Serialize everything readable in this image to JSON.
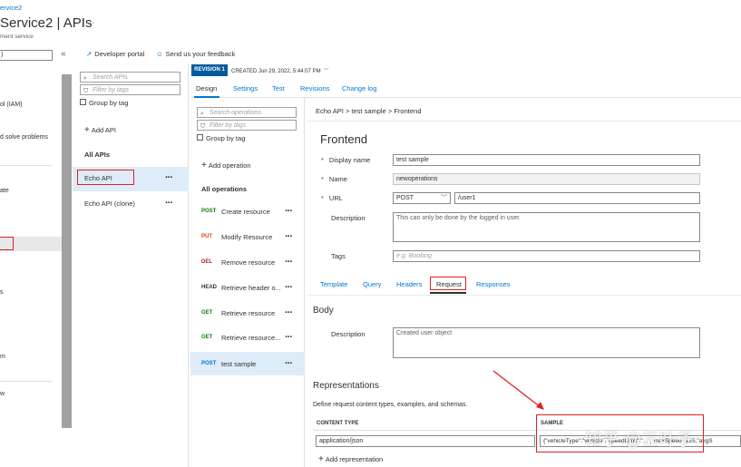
{
  "header": {
    "breadcrumb_fragment": "ervice2",
    "title": "Service2 | APIs",
    "more": "···",
    "subtitle": "ment service"
  },
  "toolbar": {
    "developer_portal": "Developer portal",
    "feedback": "Send us your feedback"
  },
  "left_nav": {
    "search_fragment": ")",
    "collapse": "«",
    "items": [
      "ol (IAM)",
      "d solve problems",
      "ate",
      "s",
      "m",
      "w"
    ]
  },
  "api_list": {
    "search_placeholder": "Search APIs",
    "filter_placeholder": "Filter by tags",
    "group_by_tag": "Group by tag",
    "add_api": "Add API",
    "all_apis": "All APIs",
    "apis": [
      "Echo API",
      "Echo API (clone)"
    ]
  },
  "revision": {
    "badge": "REVISION 1",
    "created": "CREATED Jun 29, 2022, 5:44:07 PM"
  },
  "design_tabs": [
    "Design",
    "Settings",
    "Test",
    "Revisions",
    "Change log"
  ],
  "operations": {
    "search_placeholder": "Search operations",
    "filter_placeholder": "Filter by tags",
    "group_by_tag": "Group by tag",
    "add_operation": "Add operation",
    "all_operations": "All operations",
    "items": [
      {
        "verb": "POST",
        "name": "Create resource",
        "color": "#107c10"
      },
      {
        "verb": "PUT",
        "name": "Modify Resource",
        "color": "#d83b01"
      },
      {
        "verb": "DEL",
        "name": "Remove resource",
        "color": "#a4262c"
      },
      {
        "verb": "HEAD",
        "name": "Retrieve header o...",
        "color": "#323130"
      },
      {
        "verb": "GET",
        "name": "Retrieve resource",
        "color": "#107c10"
      },
      {
        "verb": "GET",
        "name": "Retrieve resource...",
        "color": "#107c10"
      },
      {
        "verb": "POST",
        "name": "test sample",
        "color": "#0078d4"
      }
    ]
  },
  "detail": {
    "breadcrumb": [
      "Echo API",
      "test sample",
      "Frontend"
    ],
    "heading": "Frontend",
    "display_name_label": "Display name",
    "display_name_value": "test sample",
    "name_label": "Name",
    "name_value": "newoperations",
    "url_label": "URL",
    "url_method": "POST",
    "url_path": "/user1",
    "description_label": "Description",
    "description_value": "This can only be done by the logged in user.",
    "tags_label": "Tags",
    "tags_placeholder": "e.g. Booking",
    "subtabs": [
      "Template",
      "Query",
      "Headers",
      "Request",
      "Responses"
    ],
    "body_heading": "Body",
    "body_description_label": "Description",
    "body_description_value": "Created user object",
    "representations_heading": "Representations",
    "representations_desc": "Define request content types, examples, and schemas.",
    "content_type_header": "CONTENT TYPE",
    "sample_header": "SAMPLE",
    "content_type_value": "application/json",
    "sample_value": "{\"vehicleType\":\"vehicle\",\"speedLimit\":\"...\",\"maxSpeed\":125,\"avgS",
    "add_representation": "Add representation",
    "watermark": "知乎 @三叶子"
  },
  "colors": {
    "accent": "#0078d4",
    "annotation": "#e02020",
    "selected": "#deecf9"
  }
}
